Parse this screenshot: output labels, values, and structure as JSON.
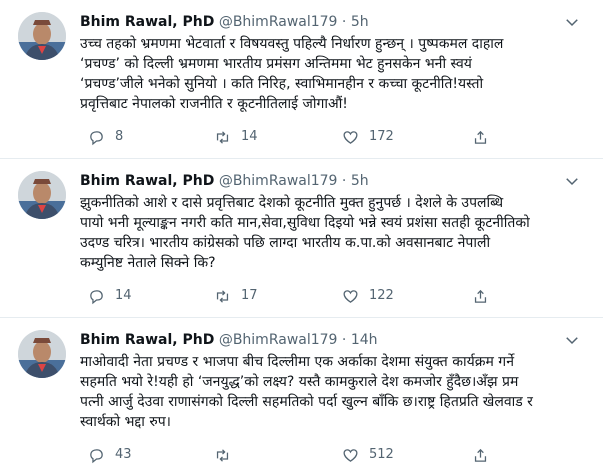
{
  "tweets": [
    {
      "name": "Bhim Rawal, PhD",
      "handle": "@BhimRawal179",
      "sep": "·",
      "time": "5h",
      "lines": [
        "उच्च तहको भ्रमणमा भेटवार्ता र विषयवस्तु पहिल्यै निर्धारण हुन्छन् । पुष्पकमल दाहाल",
        "‘प्रचण्ड’ को दिल्ली भ्रमणमा भारतीय प्रमंसग अन्तिममा भेट हुनसकेन भनी स्वयं",
        "‘प्रचण्ड’जीले भनेको सुनियो । कति निरिह, स्वाभिमानहीन र कच्चा कूटनीति!यस्तो",
        "प्रवृत्तिबाट नेपालको राजनीति र कूटनीतिलाई जोगाऔं!"
      ],
      "replies": "8",
      "retweets": "14",
      "likes": "172"
    },
    {
      "name": "Bhim Rawal, PhD",
      "handle": "@BhimRawal179",
      "sep": "·",
      "time": "5h",
      "lines": [
        "झुकनीतिको आशे र दासे प्रवृत्तिबाट देशको कूटनीति मुक्त  हुनुपर्छ । देशले के उपलब्धि",
        "पायो भनी मूल्याङ्कन नगरी कति मान,सेवा,सुविधा दिइयो भन्ने स्वयं प्रशंसा सतही कूटनीतिको",
        "उदण्ड चरित्र। भारतीय कांग्रेसको पछि लाग्दा भारतीय क.पा.को अवसानबाट  नेपाली",
        "कम्युनिष्ट नेताले सिक्ने कि?"
      ],
      "replies": "14",
      "retweets": "17",
      "likes": "122"
    },
    {
      "name": "Bhim Rawal, PhD",
      "handle": "@BhimRawal179",
      "sep": "·",
      "time": "14h",
      "lines": [
        "माओवादी नेता प्रचण्ड र भाजपा बीच दिल्लीमा एक अर्काका देशमा संयुक्त कार्यक्रम गर्ने",
        "सहमति भयो रे!यही हो ‘जनयुद्ध’को लक्ष्य? यस्तै  कामकुराले देश कमजोर हुँदैछ।अँझ प्रम",
        "पत्नी आर्जु देउवा राणासंगको दिल्ली सहमतिको पर्दा खुल्न बाँकि छ।राष्ट्र हितप्रति खेलवाड र",
        "स्वार्थको भद्दा रुप।"
      ],
      "replies": "43",
      "retweets": "",
      "likes": "512"
    }
  ],
  "icons": {
    "reply": "reply-icon",
    "retweet": "retweet-icon",
    "like": "heart-icon",
    "share": "share-icon",
    "more": "chevron-down-icon"
  },
  "colors": {
    "text": "#0f1419",
    "muted": "#536471",
    "divider": "#e6ecf0"
  }
}
